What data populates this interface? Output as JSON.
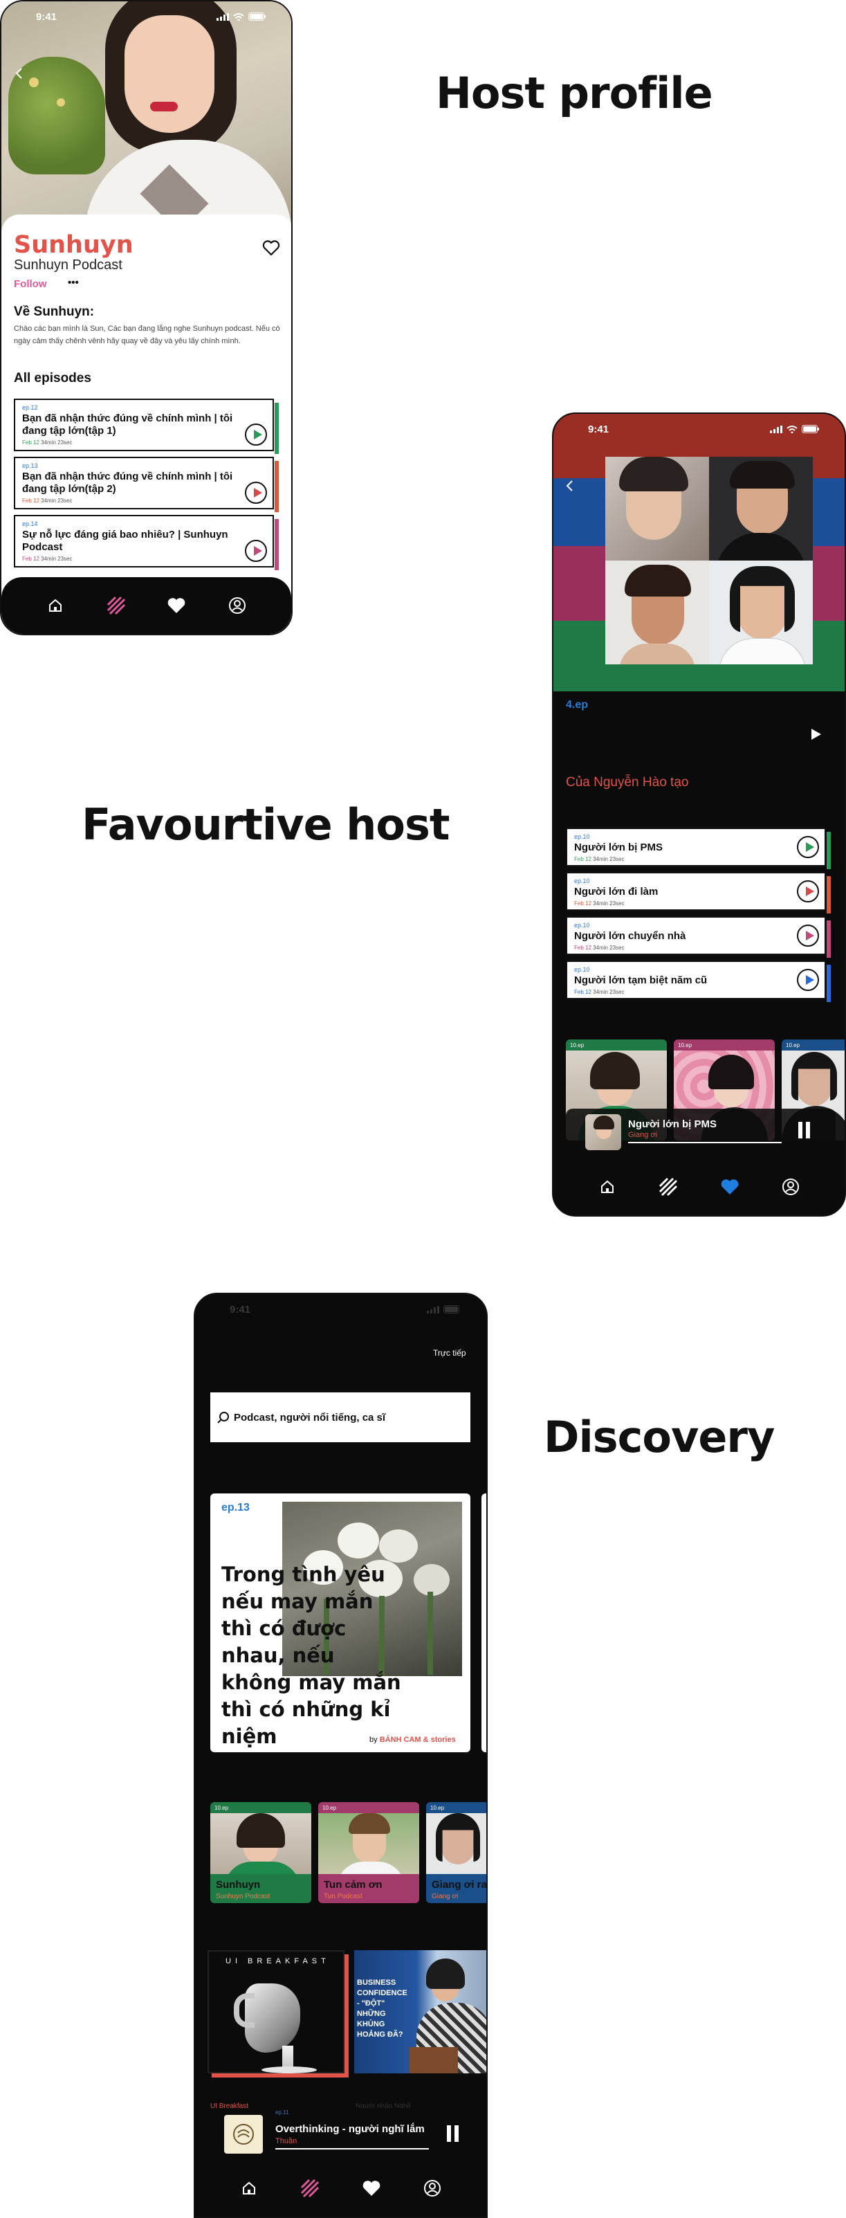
{
  "headings": {
    "host_profile": "Host profile",
    "favourite_host": "Favourtive host",
    "discovery": "Discovery"
  },
  "host_profile": {
    "status_time": "9:41",
    "name": "Sunhuyn",
    "podcast": "Sunhuyn Podcast",
    "follow": "Follow",
    "more": "•••",
    "about_title": "Về Sunhuyn:",
    "about_text": "Chào các bạn mình là Sun, Các bạn đang lắng nghe Sunhuyn podcast. Nếu có ngày cảm thấy chênh vênh hãy quay về đây và yêu lấy chính mình.",
    "episodes_title": "All episodes",
    "episodes": [
      {
        "ep": "ep.12",
        "title": "Bạn đã nhận thức đúng về chính mình | tôi đang tập lớn(tập 1)",
        "date": "Feb 12",
        "dur": "34min 23sec",
        "color": "#2a9a5a"
      },
      {
        "ep": "ep.13",
        "title": "Bạn đã nhận thức đúng về chính mình | tôi đang tập lớn(tập 2)",
        "date": "Feb 12",
        "dur": "34min 23sec",
        "color": "#d85a3a"
      },
      {
        "ep": "ep.14",
        "title": "Sự nỗ lực đáng giá bao nhiêu? | Sunhuyn Podcast",
        "date": "Feb 12",
        "dur": "34min 23sec",
        "color": "#c24a7a"
      }
    ]
  },
  "favourite": {
    "status_time": "9:41",
    "ep_count": "4.ep",
    "creator": "Của Nguyễn Hào tạo",
    "episodes": [
      {
        "ep": "ep.10",
        "title": "Người lớn bị PMS",
        "date": "Feb 12",
        "dur": "34min 23sec",
        "color": "#2a9a5a"
      },
      {
        "ep": "ep.10",
        "title": "Người lớn đi làm",
        "date": "Feb 12",
        "dur": "34min 23sec",
        "color": "#d85a3a"
      },
      {
        "ep": "ep.10",
        "title": "Người lớn chuyển nhà",
        "date": "Feb 12",
        "dur": "34min 23sec",
        "color": "#c24a7a"
      },
      {
        "ep": "ep.10",
        "title": "Người lớn tạm biệt năm cũ",
        "date": "Feb 12",
        "dur": "34min 23sec",
        "color": "#2a6ad8"
      }
    ],
    "mini_cards": [
      "10.ep",
      "10.ep",
      "10.ep"
    ],
    "now_playing": {
      "title": "Người lớn bị PMS",
      "host": "Giang ơi"
    }
  },
  "discovery": {
    "status_time": "9:41",
    "live": "Trực tiếp",
    "search_placeholder": "Podcast, người nổi tiếng, ca sĩ",
    "feature": {
      "ep": "ep.13",
      "quote": "Trong tình yêu nếu may mắn thì có được nhau, nếu không may mắn thì có những kỉ niệm",
      "by": "by",
      "brand": "BÁNH CAM & stories"
    },
    "hosts": [
      {
        "tag": "10.ep",
        "name": "Sunhuyn",
        "sub": "Sunhuyn Podcast",
        "bg": "#1f7a45",
        "sub_color": "#f07a4a"
      },
      {
        "tag": "10.ep",
        "name": "Tun cảm ơn",
        "sub": "Tun Podcast",
        "bg": "#a23a6a",
        "sub_color": "#f07a4a"
      },
      {
        "tag": "10.ep",
        "name": "Giang ơi rad",
        "sub": "Giang ơi",
        "bg": "#1a4f8a",
        "sub_color": "#f07a4a"
      }
    ],
    "shows": [
      {
        "title": "UI BREAKFAST",
        "label": "UI Breakfast"
      },
      {
        "title": "BUSINESS CONFIDENCE - \"ĐỘT\" NHỮNG KHỦNG HOẢNG ĐÃ?",
        "label": "Người nhận Nghề"
      }
    ],
    "now_playing": {
      "ep": "ep.11",
      "title": "Overthinking - người nghĩ lắm",
      "host": "Thuần"
    }
  },
  "colors": {
    "accent_red": "#e2534a",
    "green": "#1f7a45",
    "pink": "#c24a7a",
    "blue": "#2a6ad8",
    "heart_blue": "#1e7fe0",
    "dark": "#0b0b0b"
  }
}
